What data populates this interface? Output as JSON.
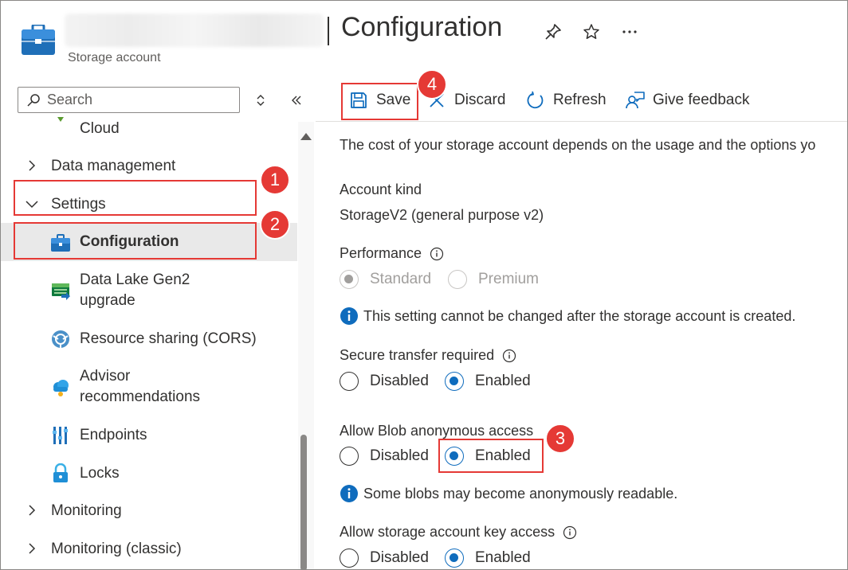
{
  "header": {
    "title": "Configuration",
    "subtitle": "Storage account"
  },
  "sidebar": {
    "search_placeholder": "Search",
    "cloud_label": "Cloud",
    "groups": [
      {
        "label": "Data management"
      },
      {
        "label": "Settings"
      }
    ],
    "settings_items": [
      {
        "label": "Configuration"
      },
      {
        "label": "Data Lake Gen2 upgrade"
      },
      {
        "label": "Resource sharing (CORS)"
      },
      {
        "label": "Advisor recommendations"
      },
      {
        "label": "Endpoints"
      },
      {
        "label": "Locks"
      }
    ],
    "bottom_groups": [
      {
        "label": "Monitoring"
      },
      {
        "label": "Monitoring (classic)"
      }
    ]
  },
  "toolbar": {
    "save": "Save",
    "discard": "Discard",
    "refresh": "Refresh",
    "feedback": "Give feedback"
  },
  "content": {
    "intro": "The cost of your storage account depends on the usage and the options yo",
    "account_kind_label": "Account kind",
    "account_kind_value": "StorageV2 (general purpose v2)",
    "performance_label": "Performance",
    "performance_options": [
      "Standard",
      "Premium"
    ],
    "performance_selected": "Standard",
    "performance_notice": "This setting cannot be changed after the storage account is created.",
    "secure_transfer_label": "Secure transfer required",
    "secure_transfer_options": [
      "Disabled",
      "Enabled"
    ],
    "secure_transfer_selected": "Enabled",
    "blob_anon_label": "Allow Blob anonymous access",
    "blob_anon_options": [
      "Disabled",
      "Enabled"
    ],
    "blob_anon_selected": "Enabled",
    "blob_anon_notice": "Some blobs may become anonymously readable.",
    "key_access_label": "Allow storage account key access",
    "key_access_options": [
      "Disabled",
      "Enabled"
    ],
    "key_access_selected": "Enabled"
  },
  "annotations": [
    "1",
    "2",
    "3",
    "4"
  ],
  "colors": {
    "accent": "#0f6cbd",
    "annotation": "#e53935",
    "selected_bg": "#e9e9e9"
  }
}
